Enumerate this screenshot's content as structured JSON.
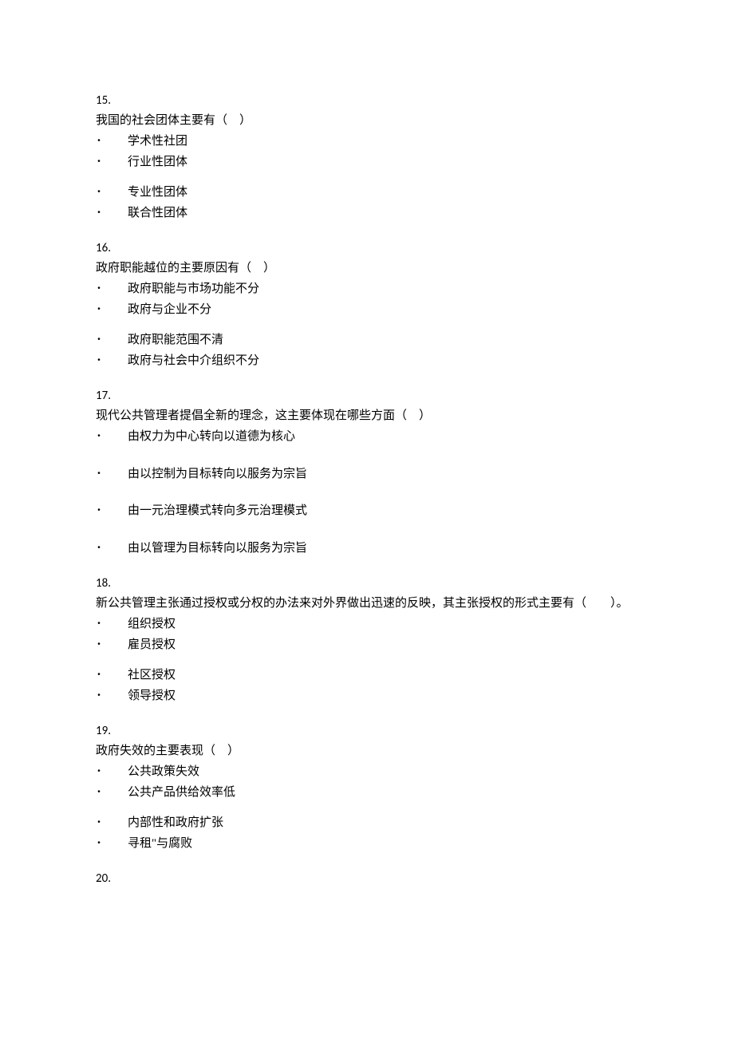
{
  "questions": [
    {
      "number": "15.",
      "stem": "我国的社会团体主要有（　）",
      "options": [
        "学术性社团",
        "行业性团体",
        "专业性团体",
        "联合性团体"
      ],
      "gapBefore": [
        false,
        false,
        true,
        false
      ]
    },
    {
      "number": "16.",
      "stem": "政府职能越位的主要原因有（　）",
      "options": [
        "政府职能与市场功能不分",
        "政府与企业不分",
        "政府职能范围不清",
        "政府与社会中介组织不分"
      ],
      "gapBefore": [
        false,
        false,
        true,
        false
      ]
    },
    {
      "number": "17.",
      "stem": "现代公共管理者提倡全新的理念，这主要体现在哪些方面（　）",
      "options": [
        "由权力为中心转向以道德为核心",
        "由以控制为目标转向以服务为宗旨",
        "由一元治理模式转向多元治理模式",
        "由以管理为目标转向以服务为宗旨"
      ],
      "gapBefore": [
        false,
        true,
        true,
        true
      ],
      "big": true
    },
    {
      "number": "18.",
      "stem": "新公共管理主张通过授权或分权的办法来对外界做出迅速的反映，其主张授权的形式主要有（　　）。",
      "options": [
        "组织授权",
        "雇员授权",
        "社区授权",
        "领导授权"
      ],
      "gapBefore": [
        false,
        false,
        true,
        false
      ]
    },
    {
      "number": "19.",
      "stem": "政府失效的主要表现（　）",
      "options": [
        "公共政策失效",
        "公共产品供给效率低",
        "内部性和政府扩张",
        "寻租\"与腐败"
      ],
      "gapBefore": [
        false,
        false,
        true,
        false
      ]
    },
    {
      "number": "20.",
      "stem": "",
      "options": [],
      "gapBefore": []
    }
  ]
}
